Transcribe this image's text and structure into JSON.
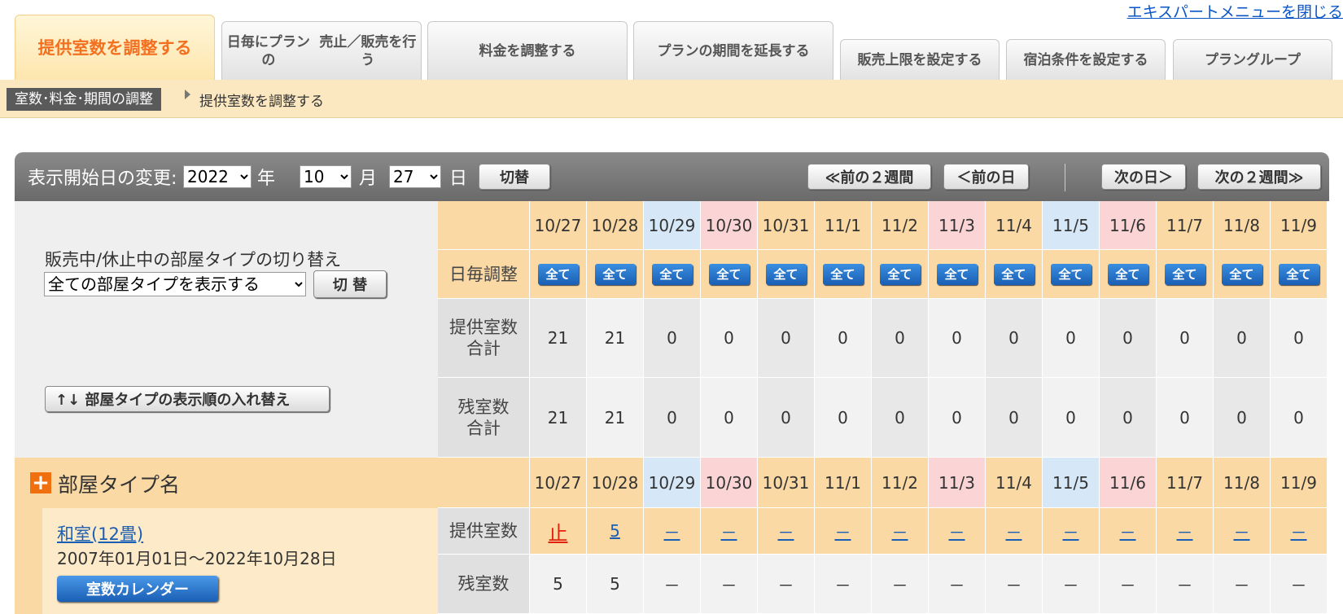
{
  "expert_menu_close": "エキスパートメニューを閉じる",
  "tabs": [
    {
      "line1": "提供室数を調整する",
      "line2": "",
      "active": true
    },
    {
      "line1": "日毎にプランの",
      "line2": "売止／販売を行う",
      "active": false
    },
    {
      "line1": "料金を調整する",
      "line2": "",
      "active": false
    },
    {
      "line1": "プランの期間を",
      "line2": "延長する",
      "active": false
    },
    {
      "line1": "販売上限を設定する",
      "line2": "",
      "active": false
    },
    {
      "line1": "宿泊条件を設定する",
      "line2": "",
      "active": false
    },
    {
      "line1": "プラングループ",
      "line2": "",
      "active": false
    }
  ],
  "breadcrumb": {
    "parent": "室数･料金･期間の調整",
    "current": "提供室数を調整する"
  },
  "controls": {
    "label": "表示開始日の変更:",
    "year": "2022",
    "year_unit": "年",
    "month": "10",
    "month_unit": "月",
    "day": "27",
    "day_unit": "日",
    "switch_button": "切替",
    "prev_2weeks": "≪前の２週間",
    "prev_day": "＜前の日",
    "next_day": "次の日＞",
    "next_2weeks": "次の２週間≫"
  },
  "left_panel": {
    "switch_label": "販売中/休止中の部屋タイプの切り替え",
    "room_filter": "全ての部屋タイプを表示する",
    "switch_button": "切 替",
    "reorder_button": "↑↓ 部屋タイプの表示順の入れ替え"
  },
  "dates": [
    {
      "label": "10/27",
      "tone": "orange"
    },
    {
      "label": "10/28",
      "tone": "orange"
    },
    {
      "label": "10/29",
      "tone": "blue"
    },
    {
      "label": "10/30",
      "tone": "pink"
    },
    {
      "label": "10/31",
      "tone": "orange"
    },
    {
      "label": "11/1",
      "tone": "orange"
    },
    {
      "label": "11/2",
      "tone": "orange"
    },
    {
      "label": "11/3",
      "tone": "pink"
    },
    {
      "label": "11/4",
      "tone": "orange"
    },
    {
      "label": "11/5",
      "tone": "blue"
    },
    {
      "label": "11/6",
      "tone": "pink"
    },
    {
      "label": "11/7",
      "tone": "orange"
    },
    {
      "label": "11/8",
      "tone": "orange"
    },
    {
      "label": "11/9",
      "tone": "orange"
    }
  ],
  "summary": {
    "daily_label": "日毎調整",
    "all_button": "全て",
    "offered_total_label": "提供室数\n合計",
    "offered_total": [
      "21",
      "21",
      "0",
      "0",
      "0",
      "0",
      "0",
      "0",
      "0",
      "0",
      "0",
      "0",
      "0",
      "0"
    ],
    "remaining_total_label": "残室数\n合計",
    "remaining_total": [
      "21",
      "21",
      "0",
      "0",
      "0",
      "0",
      "0",
      "0",
      "0",
      "0",
      "0",
      "0",
      "0",
      "0"
    ]
  },
  "room_section": {
    "header": "部屋タイプ名",
    "plus_icon": "+",
    "room_name": "和室(12畳)",
    "room_period": "2007年01月01日～2022年10月28日",
    "calendar_button": "室数カレンダー",
    "offered_label": "提供室数",
    "offered": [
      "止",
      "5",
      "－",
      "－",
      "－",
      "－",
      "－",
      "－",
      "－",
      "－",
      "－",
      "－",
      "－",
      "－"
    ],
    "remaining_label": "残室数",
    "remaining": [
      "5",
      "5",
      "－",
      "－",
      "－",
      "－",
      "－",
      "－",
      "－",
      "－",
      "－",
      "－",
      "－",
      "－"
    ]
  },
  "colors": {
    "orange": "#fbd9a4",
    "blue": "#d6e8f7",
    "pink": "#fbd5d5",
    "grey_cell": "#f2f2f2",
    "grey_cell_alt": "#e8e8e8",
    "accent": "#f37021",
    "link": "#1a5fb4"
  }
}
